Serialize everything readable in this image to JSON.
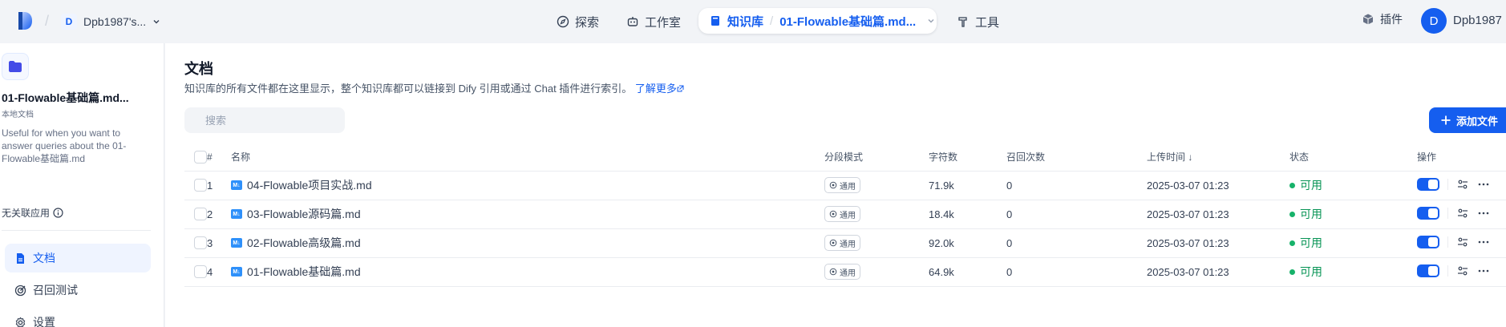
{
  "topbar": {
    "workspace_badge": "D",
    "workspace_name": "Dpb1987's...",
    "nav": {
      "explore": "探索",
      "studio": "工作室",
      "knowledge": "知识库",
      "current_kb": "01-Flowable基础篇.md...",
      "tools": "工具"
    },
    "plugins": "插件",
    "avatar_letter": "D",
    "user_name": "Dpb1987"
  },
  "sidebar": {
    "kb_name": "01-Flowable基础篇.md...",
    "kb_type": "本地文档",
    "kb_description": "Useful for when you want to answer queries about the 01-Flowable基础篇.md",
    "related_apps": "无关联应用",
    "items": [
      {
        "label": "文档",
        "icon": "document-icon",
        "active": true
      },
      {
        "label": "召回测试",
        "icon": "target-icon",
        "active": false
      },
      {
        "label": "设置",
        "icon": "gear-icon",
        "active": false
      }
    ]
  },
  "main": {
    "title": "文档",
    "description": "知识库的所有文件都在这里显示，整个知识库都可以链接到 Dify 引用或通过 Chat 插件进行索引。",
    "learn_more": "了解更多",
    "search_placeholder": "搜索",
    "add_button": "添加文件",
    "columns": {
      "index": "#",
      "name": "名称",
      "mode": "分段模式",
      "chars": "字符数",
      "recall": "召回次数",
      "uploaded": "上传时间 ↓",
      "status": "状态",
      "actions": "操作"
    },
    "rows": [
      {
        "index": "1",
        "name": "04-Flowable项目实战.md",
        "mode": "通用",
        "chars": "71.9k",
        "recall": "0",
        "uploaded": "2025-03-07 01:23",
        "status": "可用",
        "enabled": true
      },
      {
        "index": "2",
        "name": "03-Flowable源码篇.md",
        "mode": "通用",
        "chars": "18.4k",
        "recall": "0",
        "uploaded": "2025-03-07 01:23",
        "status": "可用",
        "enabled": true
      },
      {
        "index": "3",
        "name": "02-Flowable高级篇.md",
        "mode": "通用",
        "chars": "92.0k",
        "recall": "0",
        "uploaded": "2025-03-07 01:23",
        "status": "可用",
        "enabled": true
      },
      {
        "index": "4",
        "name": "01-Flowable基础篇.md",
        "mode": "通用",
        "chars": "64.9k",
        "recall": "0",
        "uploaded": "2025-03-07 01:23",
        "status": "可用",
        "enabled": true
      }
    ],
    "file_badge": "M↓"
  },
  "colors": {
    "accent": "#155eef",
    "status_ok": "#17b26a"
  }
}
